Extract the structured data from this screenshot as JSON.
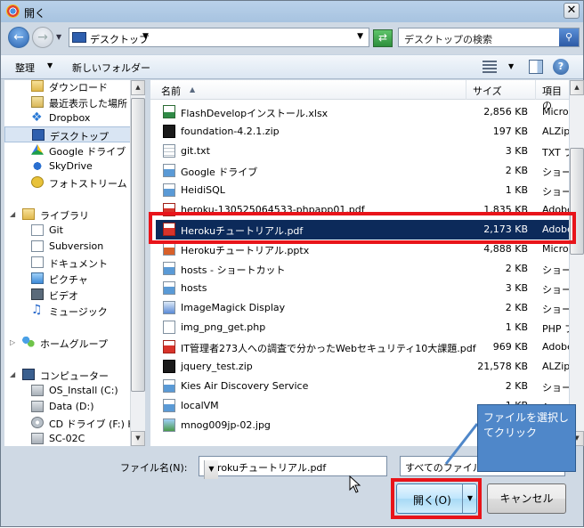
{
  "window": {
    "title": "開く",
    "close_label": "✕"
  },
  "nav": {
    "back_icon": "arrow-left-icon",
    "forward_icon": "arrow-right-icon",
    "address": {
      "location": "デスクトップ"
    },
    "search_placeholder": "デスクトップの検索"
  },
  "toolbar": {
    "organize_label": "整理",
    "new_folder_label": "新しいフォルダー",
    "help_label": "?"
  },
  "sidebar": {
    "items": [
      {
        "label": "ダウンロード",
        "icon": "folder-icon"
      },
      {
        "label": "最近表示した場所",
        "icon": "recent-places-icon"
      },
      {
        "label": "Dropbox",
        "icon": "dropbox-icon"
      },
      {
        "label": "デスクトップ",
        "icon": "desktop-icon",
        "selected": true
      },
      {
        "label": "Google ドライブ",
        "icon": "google-drive-icon"
      },
      {
        "label": "SkyDrive",
        "icon": "skydrive-icon"
      },
      {
        "label": "フォトストリーム",
        "icon": "photo-stream-icon"
      },
      {
        "label": "ライブラリ",
        "icon": "library-icon"
      },
      {
        "label": "Git",
        "icon": "git-folder-icon"
      },
      {
        "label": "Subversion",
        "icon": "document-library-icon"
      },
      {
        "label": "ドキュメント",
        "icon": "document-library-icon"
      },
      {
        "label": "ピクチャ",
        "icon": "pictures-icon"
      },
      {
        "label": "ビデオ",
        "icon": "video-icon"
      },
      {
        "label": "ミュージック",
        "icon": "music-icon"
      },
      {
        "label": "ホームグループ",
        "icon": "homegroup-icon"
      },
      {
        "label": "コンピューター",
        "icon": "computer-icon"
      },
      {
        "label": "OS_Install (C:)",
        "icon": "drive-icon"
      },
      {
        "label": "Data (D:)",
        "icon": "drive-icon"
      },
      {
        "label": "CD ドライブ (F:) HI",
        "icon": "cd-drive-icon"
      },
      {
        "label": "SC-02C",
        "icon": "device-icon"
      }
    ]
  },
  "filelist": {
    "columns": {
      "name": "名前",
      "size": "サイズ",
      "type": "項目の"
    },
    "rows": [
      {
        "name": "FlashDevelopインストール.xlsx",
        "size": "2,856 KB",
        "type": "Micro",
        "icon": "excel-file-icon",
        "cls": "ic-xls"
      },
      {
        "name": "foundation-4.2.1.zip",
        "size": "197 KB",
        "type": "ALZip",
        "icon": "zip-file-icon",
        "cls": "ic-zip"
      },
      {
        "name": "git.txt",
        "size": "3 KB",
        "type": "TXT フ",
        "icon": "text-file-icon",
        "cls": "ic-txt"
      },
      {
        "name": "Google ドライブ",
        "size": "2 KB",
        "type": "ショー",
        "icon": "shortcut-icon",
        "cls": "ic-lnk"
      },
      {
        "name": "HeidiSQL",
        "size": "1 KB",
        "type": "ショー",
        "icon": "shortcut-icon",
        "cls": "ic-lnk"
      },
      {
        "name": "heroku-130525064533-phpapp01.pdf",
        "size": "1,835 KB",
        "type": "Adobe",
        "icon": "pdf-file-icon",
        "cls": "ic-pdf"
      },
      {
        "name": "Herokuチュートリアル.pdf",
        "size": "2,173 KB",
        "type": "Adobe",
        "icon": "pdf-file-icon",
        "cls": "ic-pdf",
        "selected": true
      },
      {
        "name": "Herokuチュートリアル.pptx",
        "size": "4,888 KB",
        "type": "Micro",
        "icon": "powerpoint-file-icon",
        "cls": "ic-ppt"
      },
      {
        "name": "hosts - ショートカット",
        "size": "2 KB",
        "type": "ショー",
        "icon": "shortcut-icon",
        "cls": "ic-lnk"
      },
      {
        "name": "hosts",
        "size": "3 KB",
        "type": "ショー",
        "icon": "shortcut-icon",
        "cls": "ic-lnk"
      },
      {
        "name": "ImageMagick Display",
        "size": "2 KB",
        "type": "ショー",
        "icon": "shortcut-icon",
        "cls": "ic-exe"
      },
      {
        "name": "img_png_get.php",
        "size": "1 KB",
        "type": "PHP フ",
        "icon": "php-file-icon",
        "cls": "ic-php"
      },
      {
        "name": "IT管理者273人への調査で分かったWebセキュリティ10大課題.pdf",
        "size": "969 KB",
        "type": "Adobe",
        "icon": "pdf-file-icon",
        "cls": "ic-pdf"
      },
      {
        "name": "jquery_test.zip",
        "size": "21,578 KB",
        "type": "ALZip",
        "icon": "zip-file-icon",
        "cls": "ic-zip"
      },
      {
        "name": "Kies Air Discovery Service",
        "size": "2 KB",
        "type": "ショー",
        "icon": "shortcut-icon",
        "cls": "ic-lnk"
      },
      {
        "name": "localVM",
        "size": "1 KB",
        "type": "ショー",
        "icon": "shortcut-icon",
        "cls": "ic-lnk"
      },
      {
        "name": "mnog009jp-02.jpg",
        "size": "",
        "type": "",
        "icon": "image-file-icon",
        "cls": "ic-jpg"
      }
    ]
  },
  "footer": {
    "filename_label": "ファイル名(N):",
    "filename_value": "Herokuチュートリアル.pdf",
    "filetype_value": "すべてのファイル",
    "open_label": "開く(O)",
    "cancel_label": "キャンセル"
  },
  "callout": {
    "text": "ファイルを選択してクリック"
  },
  "colors": {
    "highlight": "#e8141a",
    "callout_bg": "#4f87c9",
    "selected_row": "#0c2a5a"
  }
}
